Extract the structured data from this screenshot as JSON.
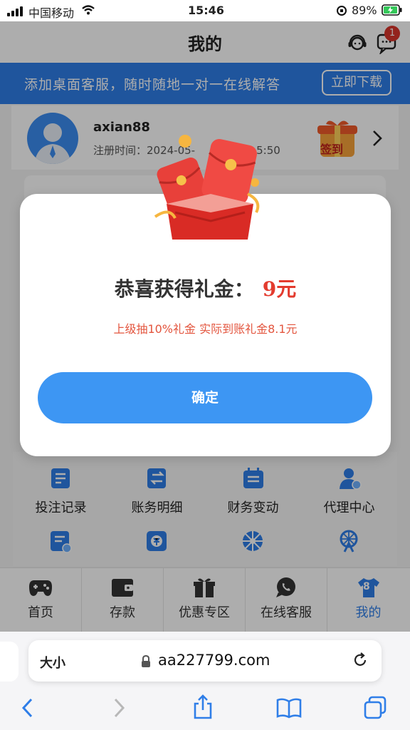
{
  "status": {
    "carrier": "中国移动",
    "time": "15:46",
    "battery": "89%"
  },
  "header": {
    "title": "我的",
    "badge": "1"
  },
  "banner": {
    "text": "添加桌面客服，随时随地一对一在线解答",
    "button": "立即下载"
  },
  "profile": {
    "username": "axian88",
    "reg_label": "注册时间：2024-05-",
    "reg_tail": "5:50",
    "checkin": "签到"
  },
  "modal": {
    "title": "恭喜获得礼金：",
    "amount": "9元",
    "subtitle": "上级抽10%礼金 实际到账礼金8.1元",
    "confirm": "确定"
  },
  "menu": [
    {
      "label": "投注记录",
      "icon": "bet-record-icon"
    },
    {
      "label": "账务明细",
      "icon": "account-detail-icon"
    },
    {
      "label": "财务变动",
      "icon": "finance-change-icon"
    },
    {
      "label": "代理中心",
      "icon": "agent-center-icon"
    }
  ],
  "tabs": [
    {
      "label": "首页",
      "icon": "gamepad-icon"
    },
    {
      "label": "存款",
      "icon": "wallet-icon"
    },
    {
      "label": "优惠专区",
      "icon": "gift-icon"
    },
    {
      "label": "在线客服",
      "icon": "chat-icon"
    },
    {
      "label": "我的",
      "icon": "jersey-icon",
      "badge": "8"
    }
  ],
  "browser": {
    "text_size": "大小",
    "url": "aa227799.com"
  },
  "colors": {
    "brand_blue": "#2f7ee8",
    "button_blue": "#3d96f3",
    "accent_red": "#e33b2e"
  }
}
